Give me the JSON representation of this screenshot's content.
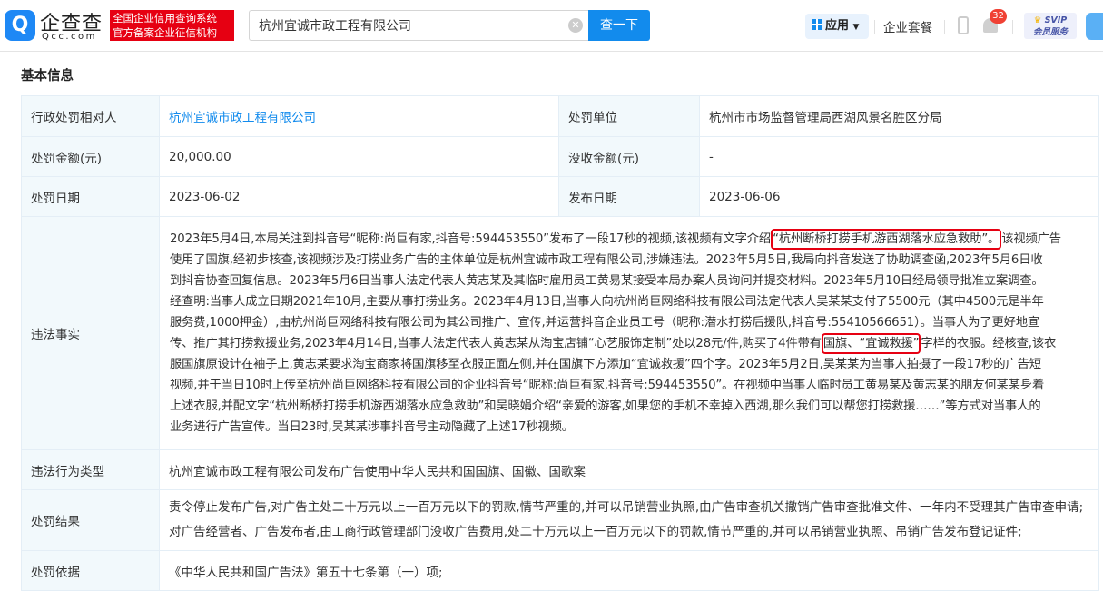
{
  "header": {
    "logo_text": "企查查",
    "logo_domain": "Qcc.com",
    "slogan_line1": "全国企业信用查询系统",
    "slogan_line2": "官方备案企业征信机构",
    "search_value": "杭州宜诚市政工程有限公司",
    "search_button": "查一下",
    "apps_label": "应用",
    "suite_label": "企业套餐",
    "notification_count": "32",
    "svip_label": "SVIP",
    "svip_sub": "会员服务"
  },
  "section_title": "基本信息",
  "info": {
    "party_label": "行政处罚相对人",
    "party_value": "杭州宜诚市政工程有限公司",
    "authority_label": "处罚单位",
    "authority_value": "杭州市市场监督管理局西湖风景名胜区分局",
    "amount_label": "处罚金额(元)",
    "amount_value": "20,000.00",
    "confiscated_label": "没收金额(元)",
    "confiscated_value": "-",
    "date_label": "处罚日期",
    "date_value": "2023-06-02",
    "publish_label": "发布日期",
    "publish_value": "2023-06-06",
    "facts_label": "违法事实",
    "facts_lines": [
      [
        "2023年5月4日,本局关注到抖音号“昵称:尚巨有家,抖音号:594453550”发布了一段17秒的视频,该视频有文字介绍",
        "“杭州断桥打捞手机游西湖落水应急救助”。",
        "该视频广告"
      ],
      [
        "使用了国旗,经初步核查,该视频涉及打捞业务广告的主体单位是杭州宜诚市政工程有限公司,涉嫌违法。2023年5月5日,我局向抖音发送了协助调查函,2023年5月6日收"
      ],
      [
        "到抖音协查回复信息。2023年5月6日当事人法定代表人黄志某及其临时雇用员工黄易某接受本局办案人员询问并提交材料。2023年5月10日经局领导批准立案调查。"
      ],
      [
        "经查明:当事人成立日期2021年10月,主要从事打捞业务。2023年4月13日,当事人向杭州尚巨网络科技有限公司法定代表人吴某某支付了5500元（其中4500元是半年"
      ],
      [
        "服务费,1000押金）,由杭州尚巨网络科技有限公司为其公司推广、宣传,并运营抖音企业员工号（昵称:潜水打捞后援队,抖音号:55410566651）。当事人为了更好地宣"
      ],
      [
        "传、推广其打捞救援业务,2023年4月14日,当事人法定代表人黄志某从淘宝店铺“心艺服饰定制”处以28元/件,购买了4件带有",
        "国旗、“宜诚救援”",
        "字样的衣服。经核查,该衣"
      ],
      [
        "服国旗原设计在袖子上,黄志某要求淘宝商家将国旗移至衣服正面左侧,并在国旗下方添加“宜诚救援”四个字。2023年5月2日,吴某某为当事人拍摄了一段17秒的广告短"
      ],
      [
        "视频,并于当日10时上传至杭州尚巨网络科技有限公司的企业抖音号“昵称:尚巨有家,抖音号:594453550”。在视频中当事人临时员工黄易某及黄志某的朋友何某某身着"
      ],
      [
        "上述衣服,并配文字“杭州断桥打捞手机游西湖落水应急救助”和吴晓娟介绍“亲爱的游客,如果您的手机不幸掉入西湖,那么我们可以帮您打捞救援……”等方式对当事人的"
      ],
      [
        "业务进行广告宣传。当日23时,吴某某涉事抖音号主动隐藏了上述17秒视频。"
      ]
    ],
    "type_label": "违法行为类型",
    "type_value": "杭州宜诚市政工程有限公司发布广告使用中华人民共和国国旗、国徽、国歌案",
    "result_label": "处罚结果",
    "result_value": "责令停止发布广告,对广告主处二十万元以上一百万元以下的罚款,情节严重的,并可以吊销营业执照,由广告审查机关撤销广告审查批准文件、一年内不受理其广告审查申请;对广告经营者、广告发布者,由工商行政管理部门没收广告费用,处二十万元以上一百万元以下的罚款,情节严重的,并可以吊销营业执照、吊销广告发布登记证件;",
    "basis_label": "处罚依据",
    "basis_value": "《中华人民共和国广告法》第五十七条第（一）项;"
  }
}
